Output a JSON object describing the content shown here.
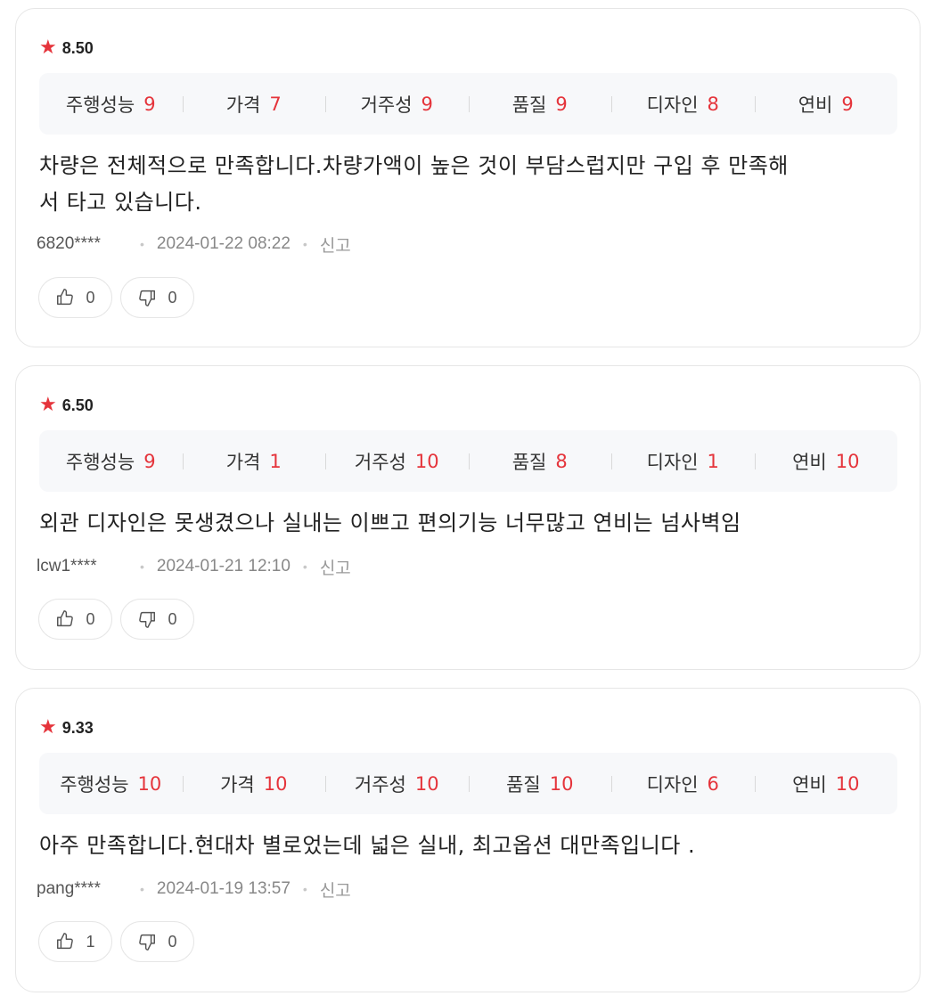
{
  "reviews": [
    {
      "score": "8.50",
      "categories": [
        {
          "label": "주행성능",
          "value": "9"
        },
        {
          "label": "가격",
          "value": "7"
        },
        {
          "label": "거주성",
          "value": "9"
        },
        {
          "label": "품질",
          "value": "9"
        },
        {
          "label": "디자인",
          "value": "8"
        },
        {
          "label": "연비",
          "value": "9"
        }
      ],
      "body_line1": "차량은 전체적으로 만족합니다.차량가액이 높은 것이 부담스럽지만 구입 후 만족해",
      "body_line2": "서 타고 있습니다.",
      "user": "6820****",
      "date": "2024-01-22 08:22",
      "report": "신고",
      "likes": "0",
      "dislikes": "0"
    },
    {
      "score": "6.50",
      "categories": [
        {
          "label": "주행성능",
          "value": "9"
        },
        {
          "label": "가격",
          "value": "1"
        },
        {
          "label": "거주성",
          "value": "10"
        },
        {
          "label": "품질",
          "value": "8"
        },
        {
          "label": "디자인",
          "value": "1"
        },
        {
          "label": "연비",
          "value": "10"
        }
      ],
      "body_line1": "외관 디자인은 못생겼으나 실내는 이쁘고 편의기능 너무많고 연비는 넘사벽임",
      "user": "lcw1****",
      "date": "2024-01-21 12:10",
      "report": "신고",
      "likes": "0",
      "dislikes": "0"
    },
    {
      "score": "9.33",
      "categories": [
        {
          "label": "주행성능",
          "value": "10"
        },
        {
          "label": "가격",
          "value": "10"
        },
        {
          "label": "거주성",
          "value": "10"
        },
        {
          "label": "품질",
          "value": "10"
        },
        {
          "label": "디자인",
          "value": "6"
        },
        {
          "label": "연비",
          "value": "10"
        }
      ],
      "body_line1": "아주 만족합니다.현대차 별로었는데 넓은 실내, 최고옵션 대만족입니다 .",
      "user": "pang****",
      "date": "2024-01-19 13:57",
      "report": "신고",
      "likes": "1",
      "dislikes": "0"
    }
  ],
  "icons": {
    "star": "star-icon",
    "like": "thumbs-up-icon",
    "dislike": "thumbs-down-icon"
  },
  "colors": {
    "accent": "#e5343b",
    "panel": "#f7f8fa",
    "border": "#e6e6e6"
  }
}
